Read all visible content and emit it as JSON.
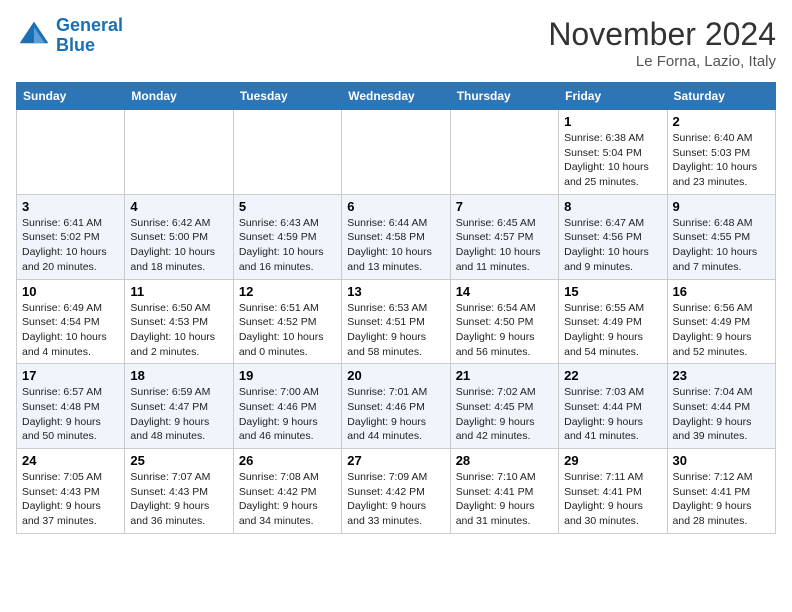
{
  "logo": {
    "line1": "General",
    "line2": "Blue"
  },
  "title": "November 2024",
  "location": "Le Forna, Lazio, Italy",
  "days_of_week": [
    "Sunday",
    "Monday",
    "Tuesday",
    "Wednesday",
    "Thursday",
    "Friday",
    "Saturday"
  ],
  "weeks": [
    [
      {
        "day": "",
        "info": ""
      },
      {
        "day": "",
        "info": ""
      },
      {
        "day": "",
        "info": ""
      },
      {
        "day": "",
        "info": ""
      },
      {
        "day": "",
        "info": ""
      },
      {
        "day": "1",
        "info": "Sunrise: 6:38 AM\nSunset: 5:04 PM\nDaylight: 10 hours\nand 25 minutes."
      },
      {
        "day": "2",
        "info": "Sunrise: 6:40 AM\nSunset: 5:03 PM\nDaylight: 10 hours\nand 23 minutes."
      }
    ],
    [
      {
        "day": "3",
        "info": "Sunrise: 6:41 AM\nSunset: 5:02 PM\nDaylight: 10 hours\nand 20 minutes."
      },
      {
        "day": "4",
        "info": "Sunrise: 6:42 AM\nSunset: 5:00 PM\nDaylight: 10 hours\nand 18 minutes."
      },
      {
        "day": "5",
        "info": "Sunrise: 6:43 AM\nSunset: 4:59 PM\nDaylight: 10 hours\nand 16 minutes."
      },
      {
        "day": "6",
        "info": "Sunrise: 6:44 AM\nSunset: 4:58 PM\nDaylight: 10 hours\nand 13 minutes."
      },
      {
        "day": "7",
        "info": "Sunrise: 6:45 AM\nSunset: 4:57 PM\nDaylight: 10 hours\nand 11 minutes."
      },
      {
        "day": "8",
        "info": "Sunrise: 6:47 AM\nSunset: 4:56 PM\nDaylight: 10 hours\nand 9 minutes."
      },
      {
        "day": "9",
        "info": "Sunrise: 6:48 AM\nSunset: 4:55 PM\nDaylight: 10 hours\nand 7 minutes."
      }
    ],
    [
      {
        "day": "10",
        "info": "Sunrise: 6:49 AM\nSunset: 4:54 PM\nDaylight: 10 hours\nand 4 minutes."
      },
      {
        "day": "11",
        "info": "Sunrise: 6:50 AM\nSunset: 4:53 PM\nDaylight: 10 hours\nand 2 minutes."
      },
      {
        "day": "12",
        "info": "Sunrise: 6:51 AM\nSunset: 4:52 PM\nDaylight: 10 hours\nand 0 minutes."
      },
      {
        "day": "13",
        "info": "Sunrise: 6:53 AM\nSunset: 4:51 PM\nDaylight: 9 hours\nand 58 minutes."
      },
      {
        "day": "14",
        "info": "Sunrise: 6:54 AM\nSunset: 4:50 PM\nDaylight: 9 hours\nand 56 minutes."
      },
      {
        "day": "15",
        "info": "Sunrise: 6:55 AM\nSunset: 4:49 PM\nDaylight: 9 hours\nand 54 minutes."
      },
      {
        "day": "16",
        "info": "Sunrise: 6:56 AM\nSunset: 4:49 PM\nDaylight: 9 hours\nand 52 minutes."
      }
    ],
    [
      {
        "day": "17",
        "info": "Sunrise: 6:57 AM\nSunset: 4:48 PM\nDaylight: 9 hours\nand 50 minutes."
      },
      {
        "day": "18",
        "info": "Sunrise: 6:59 AM\nSunset: 4:47 PM\nDaylight: 9 hours\nand 48 minutes."
      },
      {
        "day": "19",
        "info": "Sunrise: 7:00 AM\nSunset: 4:46 PM\nDaylight: 9 hours\nand 46 minutes."
      },
      {
        "day": "20",
        "info": "Sunrise: 7:01 AM\nSunset: 4:46 PM\nDaylight: 9 hours\nand 44 minutes."
      },
      {
        "day": "21",
        "info": "Sunrise: 7:02 AM\nSunset: 4:45 PM\nDaylight: 9 hours\nand 42 minutes."
      },
      {
        "day": "22",
        "info": "Sunrise: 7:03 AM\nSunset: 4:44 PM\nDaylight: 9 hours\nand 41 minutes."
      },
      {
        "day": "23",
        "info": "Sunrise: 7:04 AM\nSunset: 4:44 PM\nDaylight: 9 hours\nand 39 minutes."
      }
    ],
    [
      {
        "day": "24",
        "info": "Sunrise: 7:05 AM\nSunset: 4:43 PM\nDaylight: 9 hours\nand 37 minutes."
      },
      {
        "day": "25",
        "info": "Sunrise: 7:07 AM\nSunset: 4:43 PM\nDaylight: 9 hours\nand 36 minutes."
      },
      {
        "day": "26",
        "info": "Sunrise: 7:08 AM\nSunset: 4:42 PM\nDaylight: 9 hours\nand 34 minutes."
      },
      {
        "day": "27",
        "info": "Sunrise: 7:09 AM\nSunset: 4:42 PM\nDaylight: 9 hours\nand 33 minutes."
      },
      {
        "day": "28",
        "info": "Sunrise: 7:10 AM\nSunset: 4:41 PM\nDaylight: 9 hours\nand 31 minutes."
      },
      {
        "day": "29",
        "info": "Sunrise: 7:11 AM\nSunset: 4:41 PM\nDaylight: 9 hours\nand 30 minutes."
      },
      {
        "day": "30",
        "info": "Sunrise: 7:12 AM\nSunset: 4:41 PM\nDaylight: 9 hours\nand 28 minutes."
      }
    ]
  ]
}
